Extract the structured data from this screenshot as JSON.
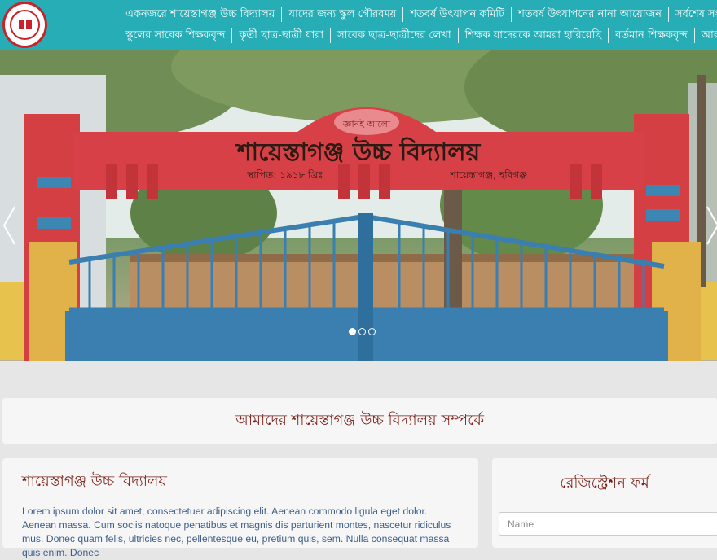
{
  "header": {
    "logo_name": "school-logo",
    "nav_row1": [
      "একনজরে শায়েস্তাগঞ্জ উচ্চ বিদ্যালয়",
      "যাদের জন্য স্কুল গৌরবময়",
      "শতবর্ষ উৎযাপন কমিটি",
      "শতবর্ষ উৎযাপনের নানা আয়োজন",
      "সর্বশেষ সংবাদ"
    ],
    "nav_row2": [
      "স্কুলের সাবেক শিক্ষকবৃন্দ",
      "কৃতী ছাত্র-ছাত্রী যারা",
      "সাবেক ছাত্র-ছাত্রীদের লেখা",
      "শিক্ষক যাদেরকে আমরা হারিয়েছি",
      "বর্তমান শিক্ষকবৃন্দ",
      "আরও"
    ]
  },
  "carousel": {
    "gate_title": "শায়েস্তাগঞ্জ উচ্চ বিদ্যালয়",
    "gate_motto": "জ্ঞানই আলো",
    "gate_established": "স্থাপিত: ১৯১৮ খ্রিঃ",
    "gate_location": "শায়েস্তাগঞ্জ, হবিগঞ্জ",
    "slides_total": 3,
    "active_slide": 1
  },
  "about": {
    "heading": "আমাদের শায়েস্তাগঞ্জ উচ্চ বিদ্যালয় সম্পর্কে"
  },
  "school": {
    "title": "শায়েস্তাগঞ্জ উচ্চ বিদ্যালয়",
    "body": "Lorem ipsum dolor sit amet, consectetuer adipiscing elit. Aenean commodo ligula eget dolor. Aenean massa. Cum sociis natoque penatibus et magnis dis parturient montes, nascetur ridiculus mus. Donec quam felis, ultricies nec, pellentesque eu, pretium quis, sem. Nulla consequat massa quis enim. Donec"
  },
  "registration": {
    "title": "রেজিস্ট্রেশন ফর্ম",
    "name_placeholder": "Name"
  },
  "colors": {
    "header": "#26adb6",
    "heading_text": "#7b1e16",
    "gate_red": "#d64046",
    "gate_blue": "#3a7fb0"
  }
}
